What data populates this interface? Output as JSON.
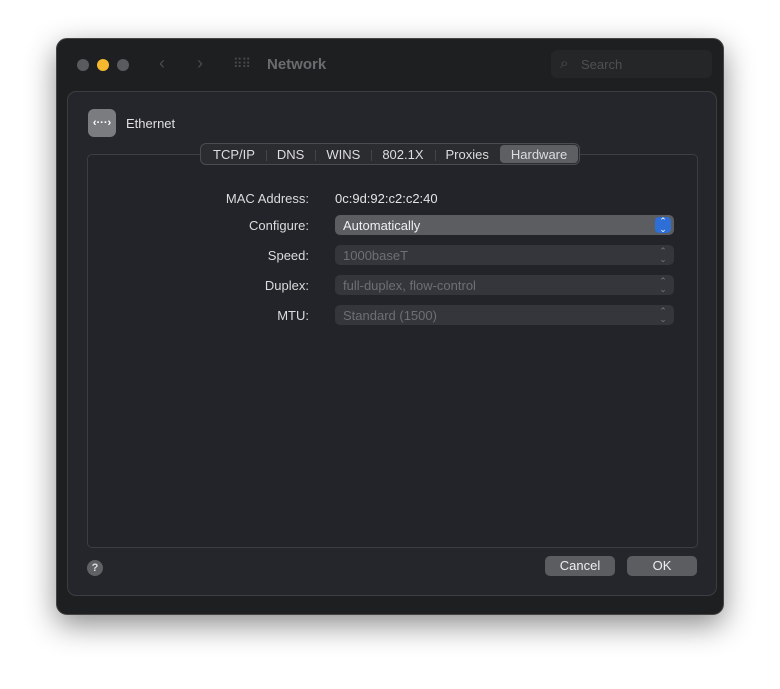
{
  "window": {
    "title": "Network",
    "search_placeholder": "Search"
  },
  "service": {
    "name": "Ethernet",
    "icon_text": "‹···›"
  },
  "tabs": [
    "TCP/IP",
    "DNS",
    "WINS",
    "802.1X",
    "Proxies",
    "Hardware"
  ],
  "selected_tab": "Hardware",
  "fields": {
    "mac_label": "MAC Address:",
    "mac_value": "0c:9d:92:c2:c2:40",
    "configure_label": "Configure:",
    "configure_value": "Automatically",
    "speed_label": "Speed:",
    "speed_value": "1000baseT",
    "duplex_label": "Duplex:",
    "duplex_value": "full-duplex, flow-control",
    "mtu_label": "MTU:",
    "mtu_value": "Standard (1500)"
  },
  "buttons": {
    "help": "?",
    "cancel": "Cancel",
    "ok": "OK"
  },
  "colors": {
    "accent": "#2d6fd6",
    "minimize": "#f5b82e"
  }
}
